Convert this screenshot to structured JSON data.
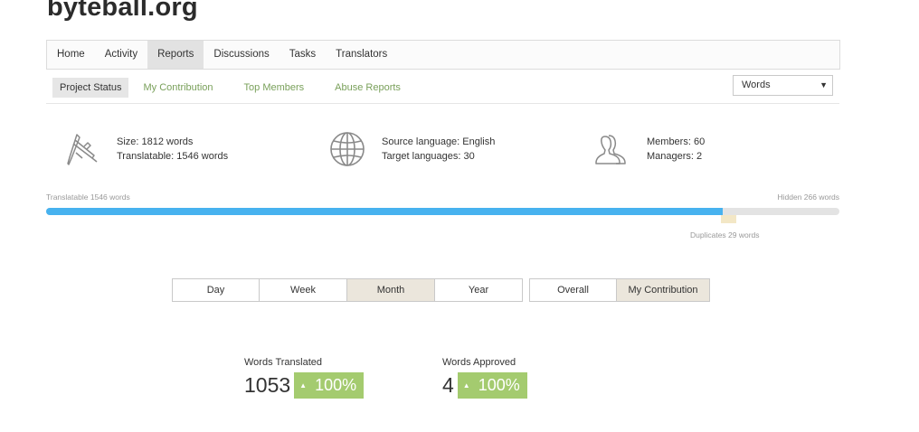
{
  "header": {
    "title": "byteball.org"
  },
  "topnav": {
    "tabs": [
      {
        "label": "Home"
      },
      {
        "label": "Activity"
      },
      {
        "label": "Reports"
      },
      {
        "label": "Discussions"
      },
      {
        "label": "Tasks"
      },
      {
        "label": "Translators"
      }
    ],
    "active_tab": "Reports"
  },
  "subnav": {
    "items": [
      {
        "label": "Project Status"
      },
      {
        "label": "My Contribution"
      },
      {
        "label": "Top Members"
      },
      {
        "label": "Abuse Reports"
      }
    ],
    "active_item": "Project Status",
    "unit_select": {
      "value": "Words"
    }
  },
  "stats": {
    "size": {
      "icon": "calipers-icon",
      "line1": "Size: 1812 words",
      "line2": "Translatable: 1546 words"
    },
    "languages": {
      "icon": "globe-icon",
      "line1": "Source language: English",
      "line2": "Target languages: 30"
    },
    "members": {
      "icon": "members-icon",
      "line1": "Members: 60",
      "line2": "Managers: 2"
    }
  },
  "progress": {
    "translatable_label": "Translatable 1546 words",
    "hidden_label": "Hidden 266 words",
    "duplicates_label": "Duplicates 29 words",
    "translatable_fraction": 0.853,
    "colors": {
      "fill": "#47b2ef",
      "track": "#e3e3e3",
      "duplicates": "#f3e7c6"
    }
  },
  "period_buttons": [
    {
      "label": "Day"
    },
    {
      "label": "Week"
    },
    {
      "label": "Month"
    },
    {
      "label": "Year"
    }
  ],
  "active_period": "Month",
  "scope_buttons": [
    {
      "label": "Overall"
    },
    {
      "label": "My Contribution"
    }
  ],
  "active_scope": "My Contribution",
  "metrics": {
    "translated": {
      "label": "Words Translated",
      "value": "1053",
      "change": "100%"
    },
    "approved": {
      "label": "Words Approved",
      "value": "4",
      "change": "100%"
    }
  },
  "colors": {
    "link_green": "#79a05a",
    "badge_green": "#a4cb6f",
    "active_tab_bg": "#e2e2e2"
  }
}
